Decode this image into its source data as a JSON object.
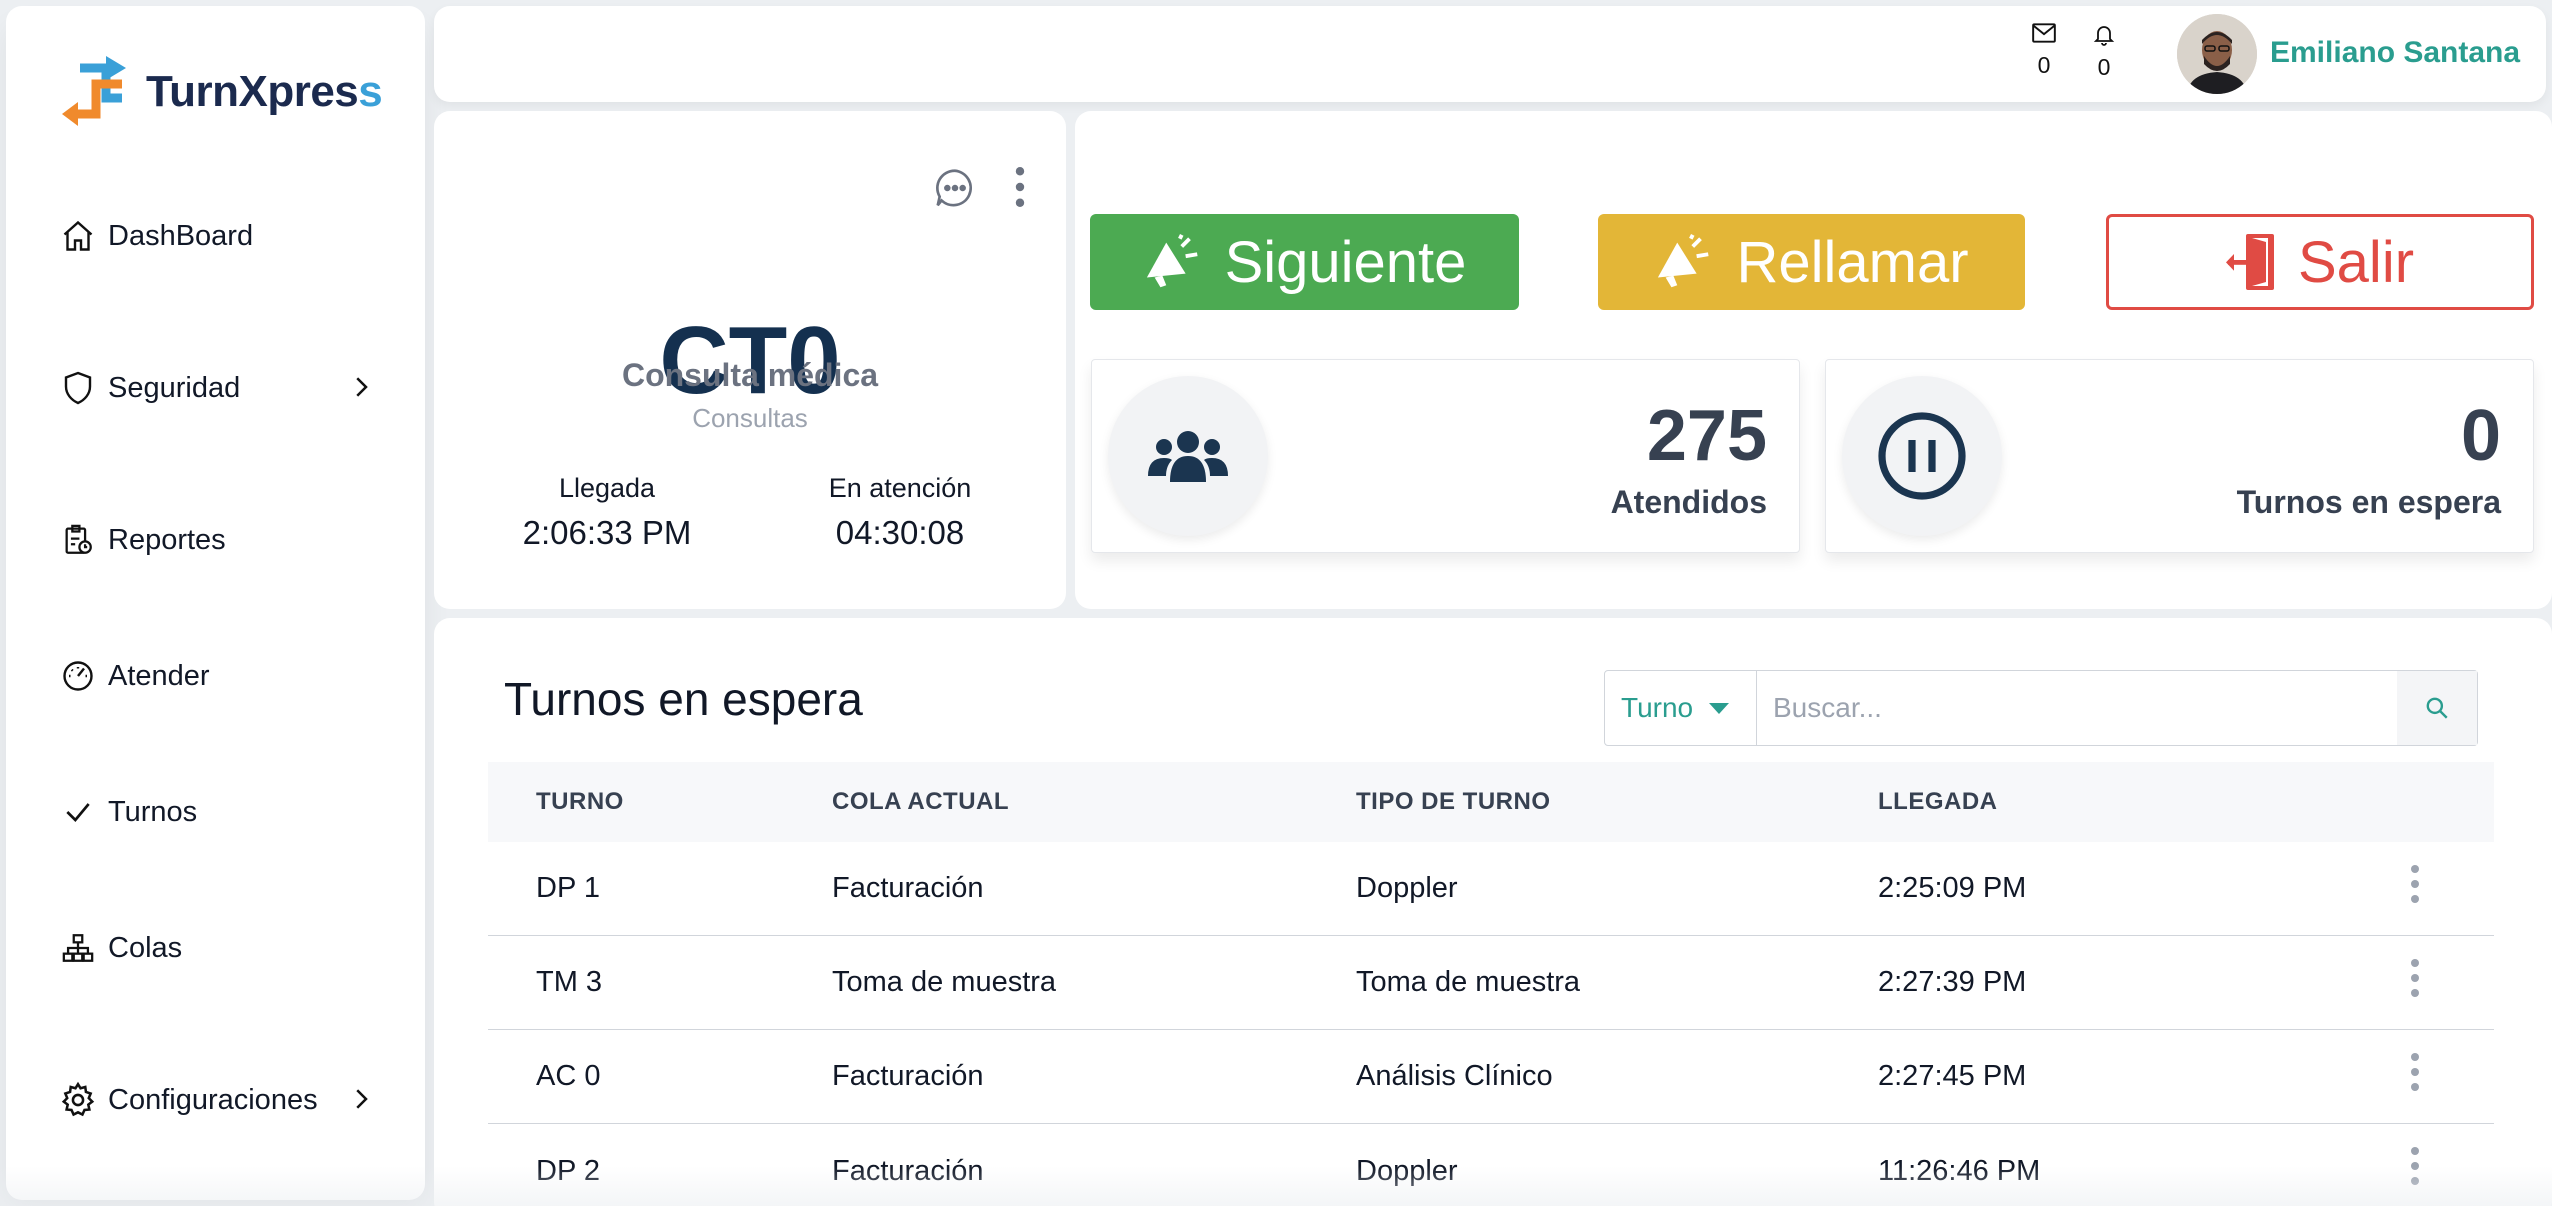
{
  "brand": {
    "name_part1": "TurnXpres",
    "name_part2": "s",
    "accent": "#3aa0d8",
    "dark": "#1b2a4e"
  },
  "sidebar": {
    "items": [
      {
        "label": "DashBoard",
        "icon": "home-icon"
      },
      {
        "label": "Seguridad",
        "icon": "shield-icon",
        "has_submenu": true
      },
      {
        "label": "Reportes",
        "icon": "report-icon"
      },
      {
        "label": "Atender",
        "icon": "gauge-icon"
      },
      {
        "label": "Turnos",
        "icon": "check-icon"
      },
      {
        "label": "Colas",
        "icon": "hierarchy-icon"
      },
      {
        "label": "Configuraciones",
        "icon": "gear-icon",
        "has_submenu": true
      }
    ]
  },
  "topbar": {
    "messages_count": "0",
    "notifications_count": "0",
    "user_name": "Emiliano Santana"
  },
  "current_turn": {
    "code": "CT0",
    "service": "Consulta médica",
    "group": "Consultas",
    "arrival_label": "Llegada",
    "arrival_value": "2:06:33 PM",
    "attention_label": "En atención",
    "attention_value": "04:30:08"
  },
  "actions": {
    "next_label": "Siguiente",
    "recall_label": "Rellamar",
    "exit_label": "Salir",
    "colors": {
      "next": "#4caa52",
      "recall": "#e3b637",
      "exit": "#e04b44"
    }
  },
  "stats": {
    "attended_value": "275",
    "attended_label": "Atendidos",
    "waiting_value": "0",
    "waiting_label": "Turnos en espera"
  },
  "queue": {
    "title": "Turnos en espera",
    "search_select": "Turno",
    "search_placeholder": "Buscar...",
    "columns": [
      "TURNO",
      "COLA ACTUAL",
      "TIPO DE TURNO",
      "LLEGADA"
    ],
    "rows": [
      [
        "DP 1",
        "Facturación",
        "Doppler",
        "2:25:09 PM"
      ],
      [
        "TM 3",
        "Toma de muestra",
        "Toma de muestra",
        "2:27:39 PM"
      ],
      [
        "AC 0",
        "Facturación",
        "Análisis Clínico",
        "2:27:45 PM"
      ],
      [
        "DP 2",
        "Facturación",
        "Doppler",
        "11:26:46 PM"
      ]
    ]
  }
}
